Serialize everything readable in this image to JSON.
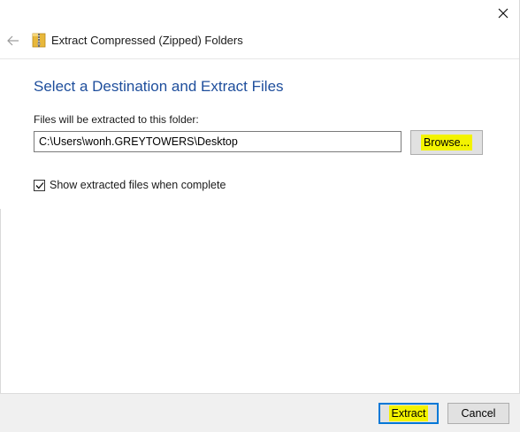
{
  "window": {
    "close_icon": "close-icon"
  },
  "header": {
    "back_icon": "back-arrow-icon",
    "folder_icon": "zipped-folder-icon",
    "title": "Extract Compressed (Zipped) Folders"
  },
  "main": {
    "heading": "Select a Destination and Extract Files",
    "path_label": "Files will be extracted to this folder:",
    "path_value": "C:\\Users\\wonh.GREYTOWERS\\Desktop",
    "browse_label": "Browse...",
    "show_files_label": "Show extracted files when complete",
    "show_files_checked": true
  },
  "footer": {
    "extract_label": "Extract",
    "cancel_label": "Cancel"
  },
  "colors": {
    "heading": "#1e4e9c",
    "highlight": "#f3f300",
    "focus_border": "#0078d7",
    "button_bg": "#e1e1e1",
    "footer_bg": "#f0f0f0"
  }
}
